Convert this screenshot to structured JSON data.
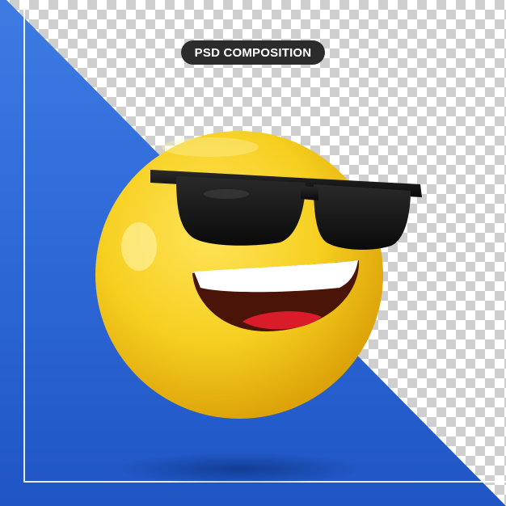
{
  "badge": {
    "label": "PSD COMPOSITION"
  },
  "colors": {
    "background_blue": "#2f6ad9",
    "face_yellow": "#f6cf1f",
    "sunglasses": "#111111",
    "mouth_red": "#d91b2a",
    "badge_bg": "#2c2c2c",
    "frame_line": "#ffffff"
  },
  "icons": [
    "sunglasses-emoji-icon"
  ]
}
